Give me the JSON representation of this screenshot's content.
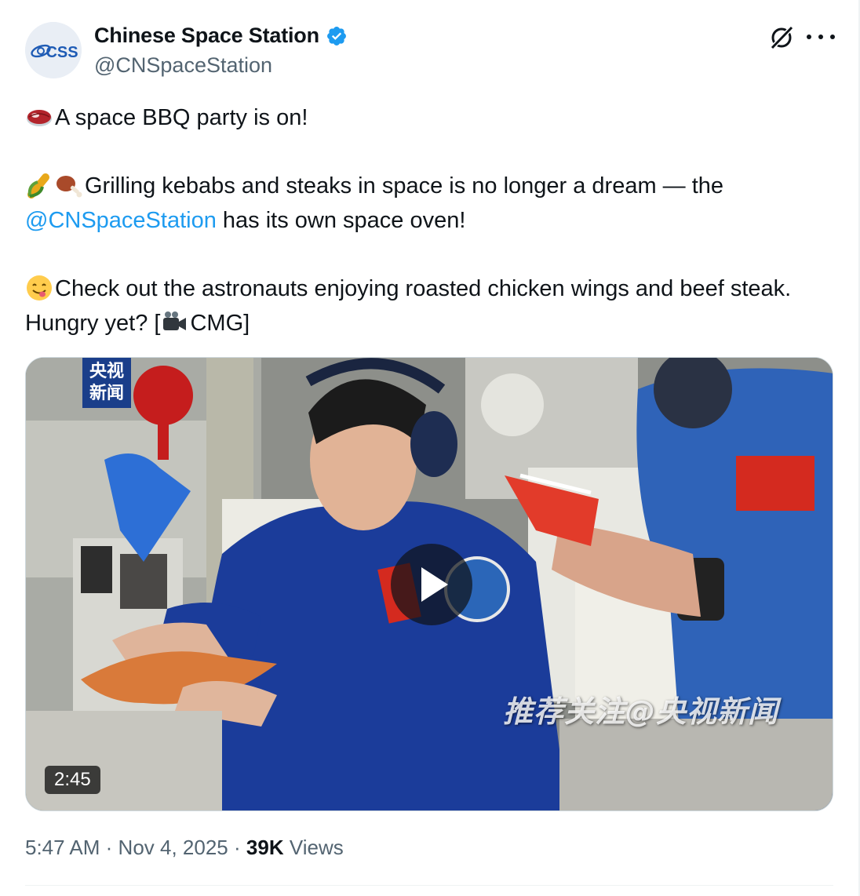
{
  "author": {
    "display_name": "Chinese Space Station",
    "handle": "@CNSpaceStation",
    "avatar_text": "CSS",
    "verified": true
  },
  "tweet": {
    "lines": [
      {
        "emoji": "meat-emoji",
        "text": "A space BBQ party is on!"
      },
      {
        "emoji": "corn-emoji",
        "emoji2": "meat-on-bone-emoji",
        "text": "Grilling kebabs and steaks in space is no longer a dream — the",
        "mention": "@CNSpaceStation",
        "text_after": " has its own space oven!"
      },
      {
        "emoji": "yum-face-emoji",
        "text": "Check out the astronauts  enjoying roasted chicken wings and beef steak. Hungry yet? [",
        "emoji_inline": "video-camera-emoji",
        "text_after": "CMG]"
      }
    ]
  },
  "video": {
    "duration": "2:45",
    "channel_logo": "央视\n新闻",
    "watermark": "推荐关注@央视新闻"
  },
  "meta": {
    "time": "5:47 AM",
    "separator": "·",
    "date": "Nov 4, 2025",
    "views_count": "39K",
    "views_label": "Views"
  },
  "colors": {
    "text": "#0f1419",
    "secondary": "#536471",
    "link": "#1d9bf0",
    "verified": "#1d9bf0"
  }
}
